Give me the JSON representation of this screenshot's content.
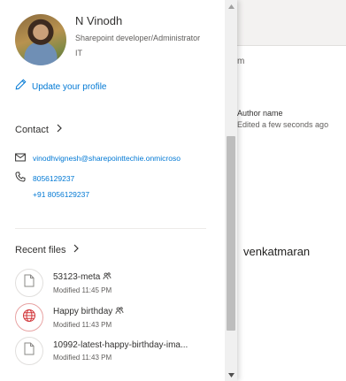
{
  "background": {
    "fragment": "m",
    "author_label": "Author name",
    "edited_text": "Edited a few seconds ago",
    "partial_name": "venkatmaran"
  },
  "profile": {
    "name": "N Vinodh",
    "title": "Sharepoint developer/Administrator",
    "department": "IT",
    "update_link": "Update your profile"
  },
  "contact": {
    "header": "Contact",
    "email": "vinodhvignesh@sharepointtechie.onmicroso",
    "phone": "8056129237",
    "phone_alt": "+91 8056129237"
  },
  "recent_files": {
    "header": "Recent files",
    "items": [
      {
        "title": "53123-meta",
        "modified": "Modified 11:45 PM",
        "icon": "document-icon",
        "shared": true
      },
      {
        "title": "Happy birthday",
        "modified": "Modified 11:43 PM",
        "icon": "globe-icon",
        "shared": true
      },
      {
        "title": "10992-latest-happy-birthday-ima...",
        "modified": "Modified 11:43 PM",
        "icon": "document-icon",
        "shared": false
      }
    ]
  },
  "colors": {
    "link": "#0078d4",
    "text": "#323130",
    "muted": "#605e5c",
    "globe_accent": "#d13438"
  }
}
